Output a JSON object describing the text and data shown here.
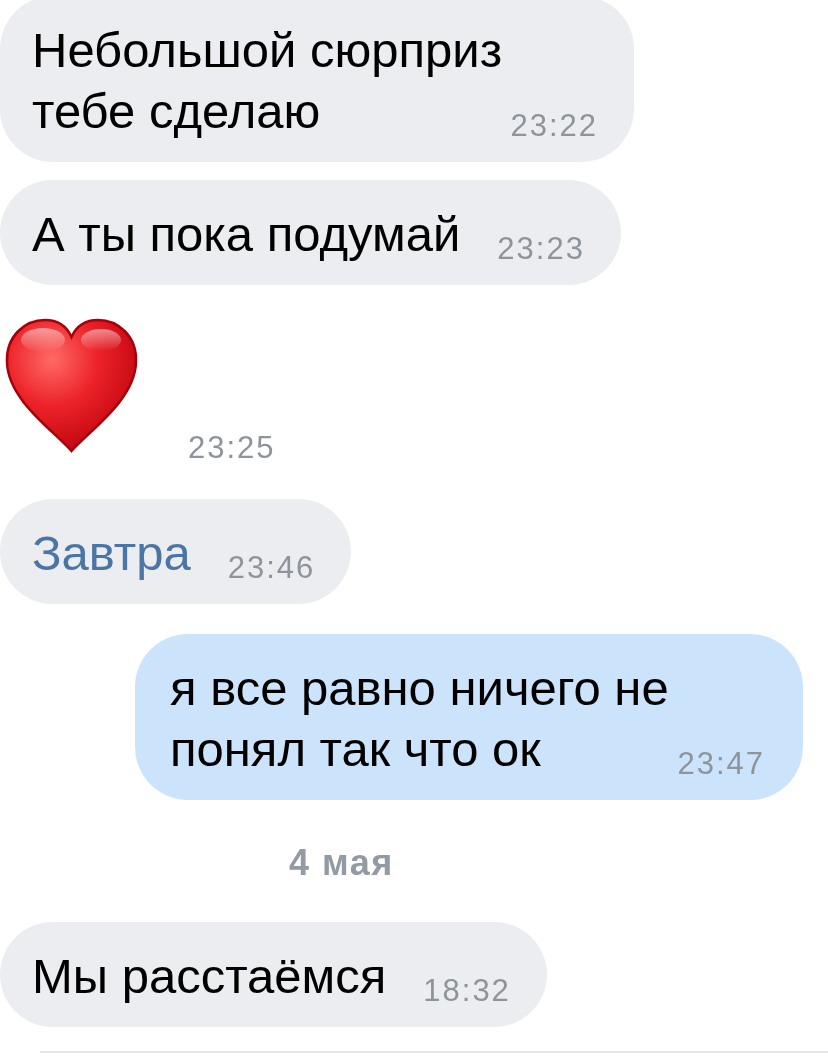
{
  "chat": {
    "items": [
      {
        "kind": "text",
        "outgoing": false,
        "text": "Небольшой сюрприз тебе сделаю",
        "link": false,
        "time": "23:22"
      },
      {
        "kind": "text",
        "outgoing": false,
        "text": "А ты пока подумай",
        "link": false,
        "time": "23:23"
      },
      {
        "kind": "emoji",
        "outgoing": false,
        "time": "23:25"
      },
      {
        "kind": "text",
        "outgoing": false,
        "text": "Завтра",
        "link": true,
        "time": "23:46"
      },
      {
        "kind": "text",
        "outgoing": true,
        "text": "я все равно ничего не понял так что ок",
        "link": false,
        "time": "23:47"
      },
      {
        "kind": "date",
        "text": "4 мая"
      },
      {
        "kind": "text",
        "outgoing": false,
        "text": "Мы расстаёмся",
        "link": false,
        "time": "18:32"
      }
    ]
  }
}
